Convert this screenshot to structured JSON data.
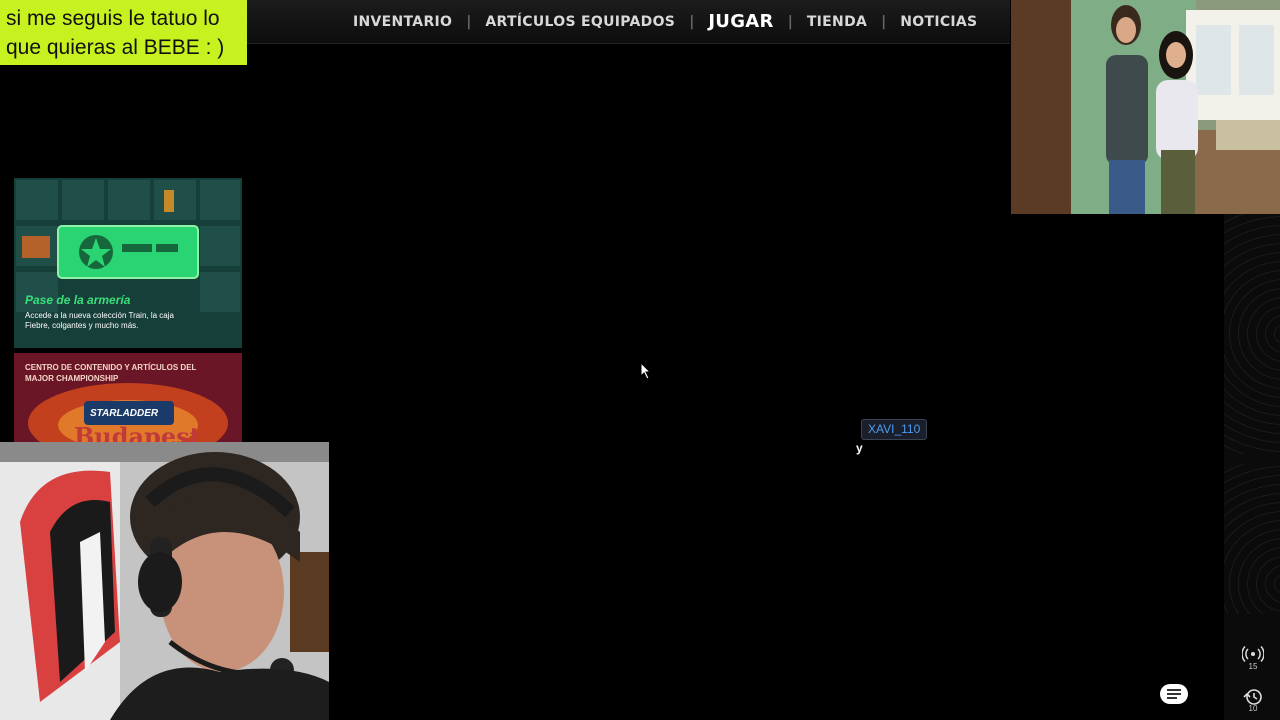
{
  "overlay": {
    "follow_text_line1": "si me seguis le tatuo lo",
    "follow_text_line2": "que quieras al BEBE : )"
  },
  "nav": {
    "items": [
      {
        "label": "INVENTARIO"
      },
      {
        "label": "ARTÍCULOS EQUIPADOS"
      },
      {
        "label": "JUGAR"
      },
      {
        "label": "TIENDA"
      },
      {
        "label": "NOTICIAS"
      }
    ]
  },
  "promos": {
    "armory": {
      "title": "Pase de la armería",
      "desc_line1": "Accede a la nueva colección Train, la caja",
      "desc_line2": "Fiebre, colgantes y mucho más."
    },
    "major": {
      "line1": "CENTRO DE CONTENIDO Y ARTÍCULOS DEL",
      "line2": "MAJOR CHAMPIONSHIP",
      "brand": "STARLADDER",
      "city": "Budapest"
    }
  },
  "chat": {
    "username": "XAVI_110",
    "message": "y"
  },
  "side_buttons": {
    "live_count": "15",
    "history_count": "10"
  },
  "colors": {
    "banner": "#c8f21f",
    "username": "#4d9cf0",
    "armory_green": "#39e07a"
  }
}
